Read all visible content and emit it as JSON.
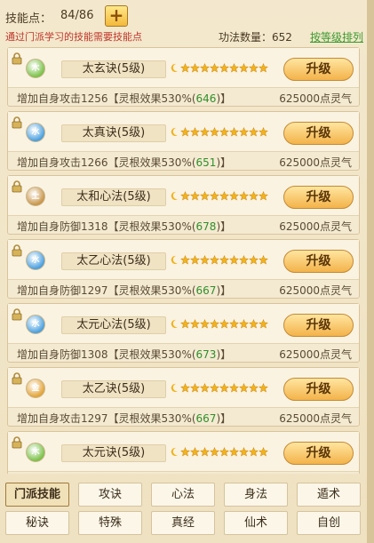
{
  "header": {
    "skill_points_label": "技能点：",
    "skill_points_value": "84/86",
    "plus_label": "+",
    "hint": "通过门派学习的技能需要技能点",
    "skill_count": "功法数量：652",
    "sort_link": "按等级排列"
  },
  "skills": [
    {
      "element": "木",
      "orb_color": "#7cc24a",
      "name": "太玄诀(5级)",
      "stars": 9,
      "upgrade": "升级",
      "desc_prefix": "增加自身攻击1256【灵根效果530%(",
      "desc_value": "646",
      "desc_suffix": ")】",
      "cost": "625000点灵气"
    },
    {
      "element": "水",
      "orb_color": "#4aa0e0",
      "name": "太真诀(5级)",
      "stars": 9,
      "upgrade": "升级",
      "desc_prefix": "增加自身攻击1266【灵根效果530%(",
      "desc_value": "651",
      "desc_suffix": ")】",
      "cost": "625000点灵气"
    },
    {
      "element": "土",
      "orb_color": "#c9964a",
      "name": "太和心法(5级)",
      "stars": 9,
      "upgrade": "升级",
      "desc_prefix": "增加自身防御1318【灵根效果530%(",
      "desc_value": "678",
      "desc_suffix": ")】",
      "cost": "625000点灵气"
    },
    {
      "element": "水",
      "orb_color": "#4aa0e0",
      "name": "太乙心法(5级)",
      "stars": 9,
      "upgrade": "升级",
      "desc_prefix": "增加自身防御1297【灵根效果530%(",
      "desc_value": "667",
      "desc_suffix": ")】",
      "cost": "625000点灵气"
    },
    {
      "element": "水",
      "orb_color": "#4aa0e0",
      "name": "太元心法(5级)",
      "stars": 9,
      "upgrade": "升级",
      "desc_prefix": "增加自身防御1308【灵根效果530%(",
      "desc_value": "673",
      "desc_suffix": ")】",
      "cost": "625000点灵气"
    },
    {
      "element": "金",
      "orb_color": "#e3a43a",
      "name": "太乙诀(5级)",
      "stars": 9,
      "upgrade": "升级",
      "desc_prefix": "增加自身攻击1297【灵根效果530%(",
      "desc_value": "667",
      "desc_suffix": ")】",
      "cost": "625000点灵气"
    },
    {
      "element": "木",
      "orb_color": "#7cc24a",
      "name": "太元诀(5级)",
      "stars": 9,
      "upgrade": "升级",
      "desc_prefix": "",
      "desc_value": "",
      "desc_suffix": "",
      "cost": ""
    }
  ],
  "tabs": [
    {
      "label": "门派技能",
      "active": true
    },
    {
      "label": "攻诀",
      "active": false
    },
    {
      "label": "心法",
      "active": false
    },
    {
      "label": "身法",
      "active": false
    },
    {
      "label": "遁术",
      "active": false
    },
    {
      "label": "秘诀",
      "active": false
    },
    {
      "label": "特殊",
      "active": false
    },
    {
      "label": "真经",
      "active": false
    },
    {
      "label": "仙术",
      "active": false
    },
    {
      "label": "自创",
      "active": false
    }
  ]
}
